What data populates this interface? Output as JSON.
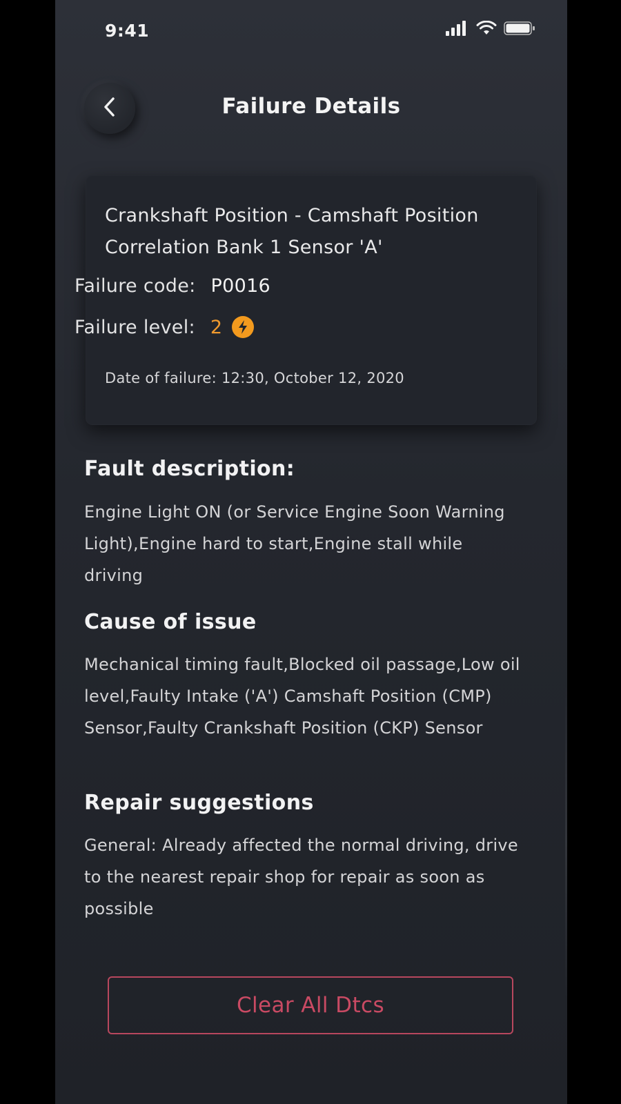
{
  "status_bar": {
    "time": "9:41",
    "icons": [
      "signal-icon",
      "wifi-icon",
      "battery-icon"
    ]
  },
  "header": {
    "title": "Failure Details",
    "back_icon": "chevron-left-icon"
  },
  "failure": {
    "name": "Crankshaft Position - Camshaft Position Correlation Bank 1 Sensor 'A'",
    "code_label": "Failure code:",
    "code": "P0016",
    "level_label": "Failure level:",
    "level": "2",
    "level_icon": "lightning-bolt-icon",
    "date_text": "Date of failure: 12:30, October 12, 2020"
  },
  "sections": {
    "fault": {
      "heading": "Fault description:",
      "body": "Engine Light ON (or Service Engine Soon Warning Light),Engine hard to start,Engine stall while driving"
    },
    "cause": {
      "heading": "Cause of issue",
      "body": "Mechanical timing fault,Blocked oil passage,Low oil level,Faulty Intake ('A') Camshaft Position (CMP) Sensor,Faulty Crankshaft Position (CKP) Sensor"
    },
    "repair": {
      "heading": "Repair suggestions",
      "body": "General: Already affected the normal driving, drive to the nearest repair shop for repair as soon as possible"
    }
  },
  "actions": {
    "clear_label": "Clear All Dtcs"
  },
  "colors": {
    "background": "#26292f",
    "card": "#22252c",
    "accent_level": "#f39a1e",
    "button_outline": "#b8475e",
    "button_text": "#c94a63"
  }
}
